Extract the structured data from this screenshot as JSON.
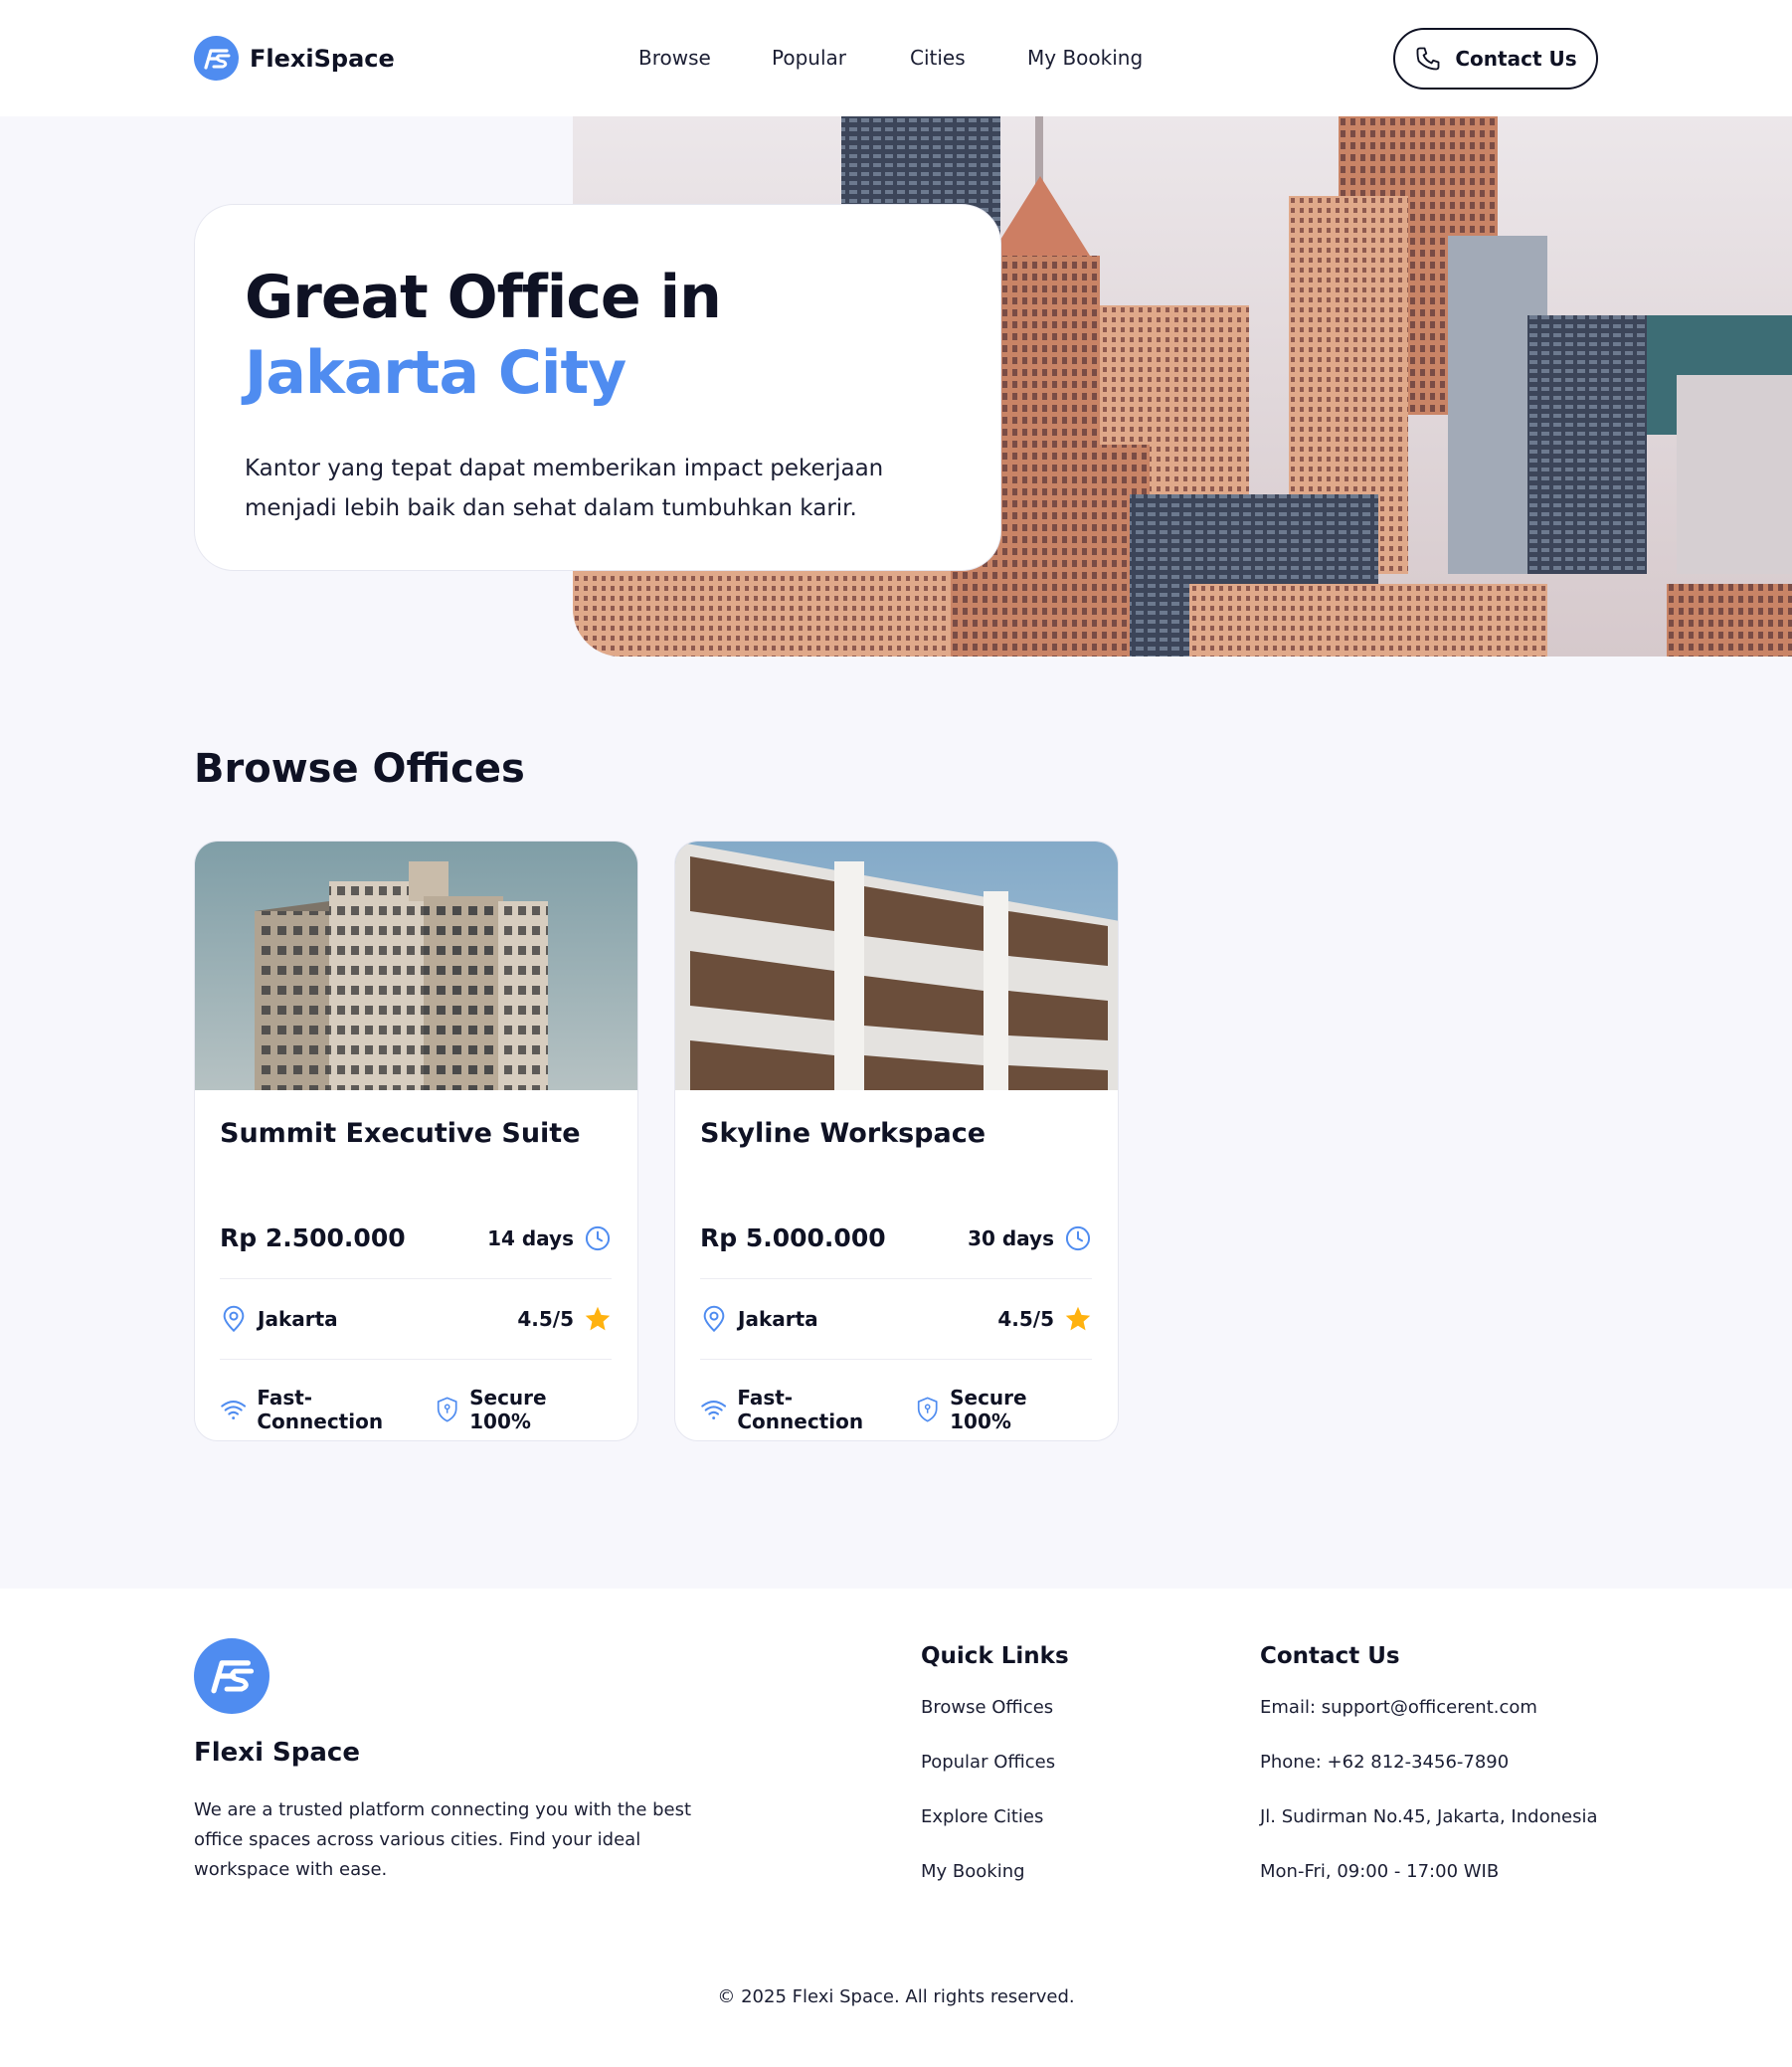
{
  "colors": {
    "accent": "#4f8cf0",
    "star": "#ffb20f",
    "navy": "#0f1224",
    "hero_bg": "#f7f7fc"
  },
  "header": {
    "brand": "FlexiSpace",
    "logo_icon": "fs-logo-icon",
    "nav": [
      "Browse",
      "Popular",
      "Cities",
      "My Booking"
    ],
    "contact_label": "Contact Us",
    "contact_icon": "phone-icon"
  },
  "hero": {
    "title_line1": "Great Office in",
    "title_line2": "Jakarta City",
    "description": "Kantor yang tepat dapat memberikan impact pekerjaan menjadi lebih baik dan sehat dalam tumbuhkan karir."
  },
  "browse": {
    "title": "Browse Offices",
    "offices": [
      {
        "name": "Summit Executive Suite",
        "price": "Rp 2.500.000",
        "duration": "14 days",
        "city": "Jakarta",
        "rating": "4.5/5",
        "feature1": "Fast-Connection",
        "feature2": "Secure 100%"
      },
      {
        "name": "Skyline Workspace",
        "price": "Rp 5.000.000",
        "duration": "30 days",
        "city": "Jakarta",
        "rating": "4.5/5",
        "feature1": "Fast-Connection",
        "feature2": "Secure 100%"
      }
    ]
  },
  "footer": {
    "brand": "Flexi Space",
    "about": "We are a trusted platform connecting you with the best office spaces across various cities. Find your ideal workspace with ease.",
    "quick_links_title": "Quick Links",
    "quick_links": [
      "Browse Offices",
      "Popular Offices",
      "Explore Cities",
      "My Booking"
    ],
    "contact_title": "Contact Us",
    "contact_items": [
      "Email: support@officerent.com",
      "Phone: +62 812-3456-7890",
      "Jl. Sudirman No.45, Jakarta, Indonesia",
      "Mon-Fri, 09:00 - 17:00 WIB"
    ],
    "copyright": "© 2025 Flexi Space. All rights reserved."
  }
}
